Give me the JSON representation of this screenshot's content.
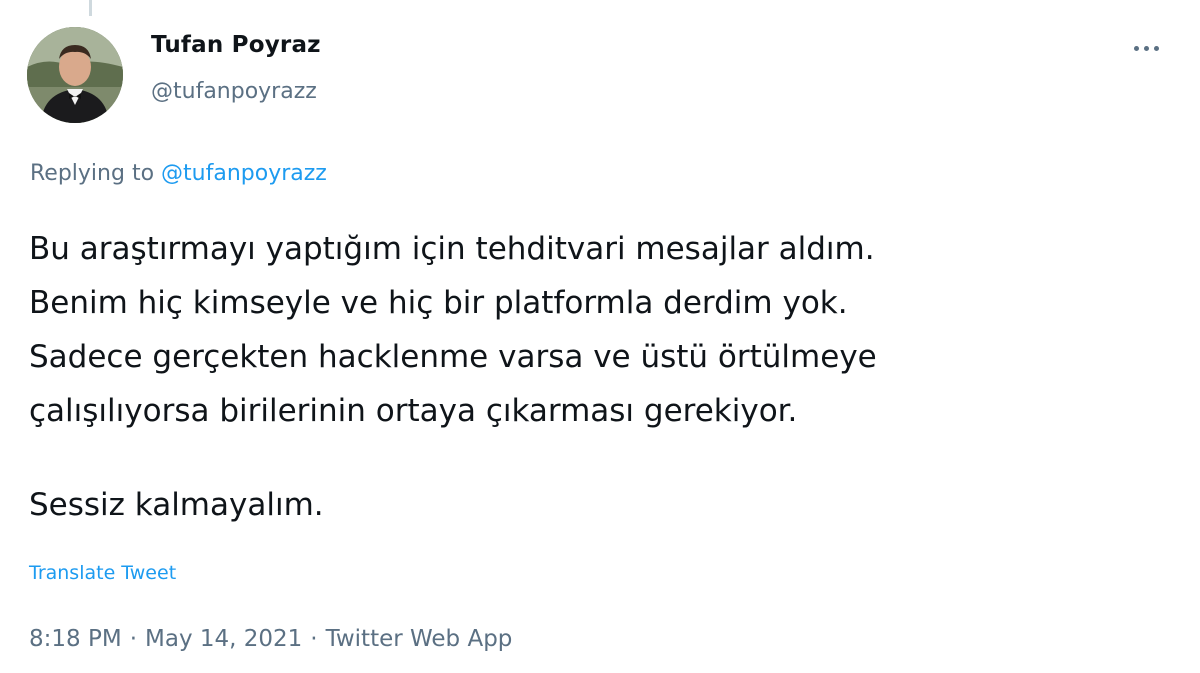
{
  "author": {
    "display_name": "Tufan Poyraz",
    "handle": "@tufanpoyrazz"
  },
  "reply": {
    "prefix": "Replying to",
    "mention": "@tufanpoyrazz"
  },
  "tweet": {
    "paragraph1_lines": [
      "Bu araştırmayı yaptığım için tehditvari mesajlar aldım.",
      "Benim hiç kimseyle ve hiç bir platformla derdim yok.",
      "Sadece gerçekten hacklenme varsa ve üstü örtülmeye",
      "çalışılıyorsa birilerinin ortaya çıkarması gerekiyor."
    ],
    "paragraph2": "Sessiz kalmayalım."
  },
  "translate_label": "Translate Tweet",
  "meta": {
    "time": "8:18 PM",
    "separator": "·",
    "date": "May 14, 2021",
    "source": "Twitter Web App"
  },
  "icons": {
    "more": "more-horizontal-icon"
  },
  "colors": {
    "text": "#0f1419",
    "secondary": "#5b7083",
    "link": "#1d9bf0"
  }
}
